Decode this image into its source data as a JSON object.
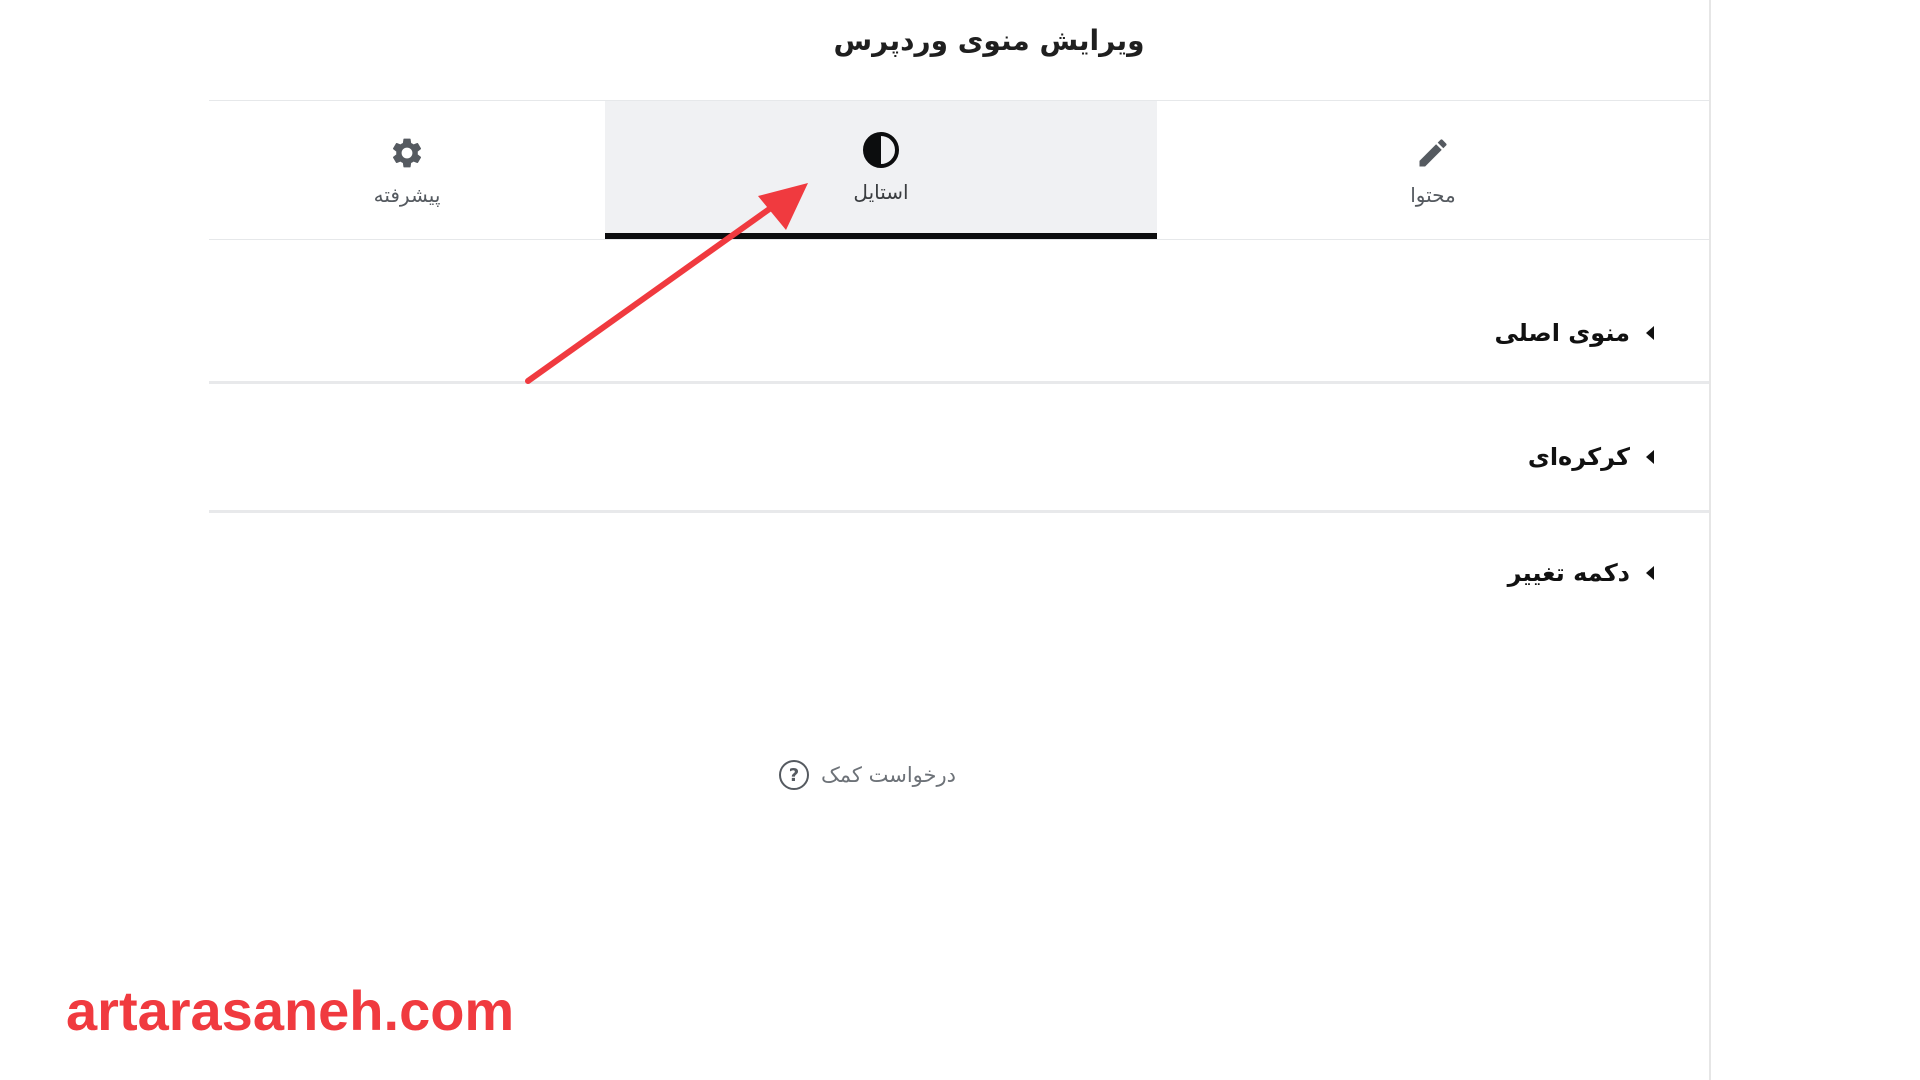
{
  "header": {
    "title": "ویرایش منوی وردپرس"
  },
  "tabs": [
    {
      "label": "محتوا",
      "icon": "pencil-icon",
      "active": false
    },
    {
      "label": "استایل",
      "icon": "contrast-icon",
      "active": true
    },
    {
      "label": "پیشرفته",
      "icon": "gear-icon",
      "active": false
    }
  ],
  "sections": [
    {
      "label": "منوی اصلی",
      "icon": "caret-left-icon"
    },
    {
      "label": "کرکره‌ای",
      "icon": "caret-left-icon"
    },
    {
      "label": "دکمه تغییر",
      "icon": "caret-left-icon"
    }
  ],
  "help": {
    "label": "درخواست کمک",
    "icon": "question-circle-icon",
    "icon_glyph": "?"
  },
  "annotation": {
    "arrow_color": "#f03a3f"
  },
  "watermark": {
    "text": "artarasaneh.com",
    "color": "#f03a3f"
  },
  "colors": {
    "active_tab_bg": "#f0f1f3",
    "active_tab_indicator": "#0c0d0e"
  }
}
